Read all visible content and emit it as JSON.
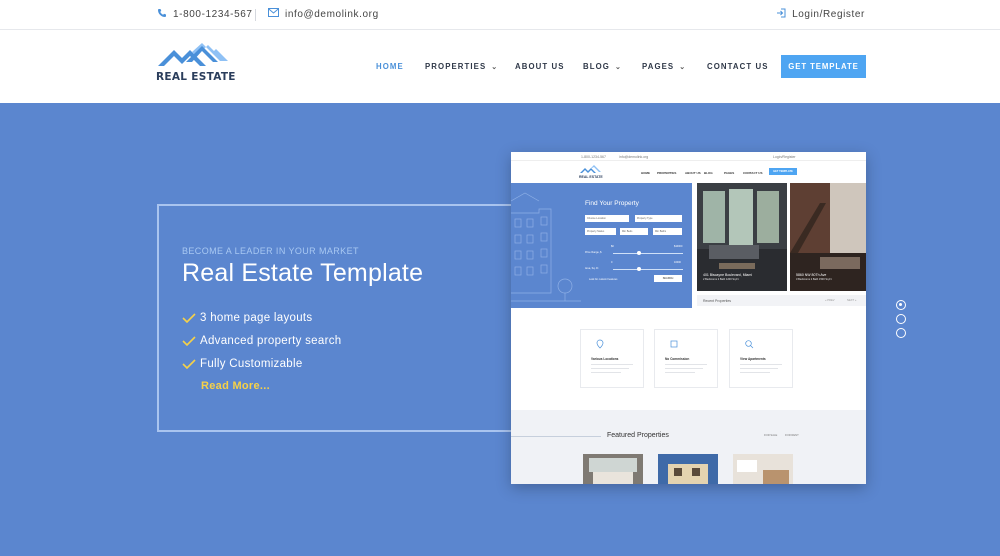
{
  "topbar": {
    "phone": "1-800-1234-567",
    "email": "info@demolink.org",
    "login": "Login/Register",
    "icons": [
      "phone-icon",
      "mail-icon",
      "login-icon"
    ]
  },
  "header": {
    "logo_text": "REAL ESTATE",
    "nav": {
      "home": "HOME",
      "properties": "PROPERTIES",
      "about": "ABOUT US",
      "blog": "BLOG",
      "pages": "PAGES",
      "contact": "CONTACT US"
    },
    "cta": "GET TEMPLATE"
  },
  "hero": {
    "eyebrow": "BECOME A LEADER IN YOUR MARKET",
    "title": "Real Estate Template",
    "features": [
      "3 home page layouts",
      "Advanced property search",
      "Fully Customizable"
    ],
    "read_more": "Read More..."
  },
  "preview": {
    "phone": "1-800-1234-567",
    "email": "info@demolink.org",
    "login": "Login/Register",
    "logo_text": "REAL ESTATE",
    "nav": [
      "HOME",
      "PROPERTIES",
      "ABOUT US",
      "BLOG",
      "PAGES",
      "CONTACT US"
    ],
    "cta": "GET TEMPLATE",
    "search_title": "Find Your Property",
    "fields": [
      "Choose Location",
      "Property Type",
      "Property Status",
      "Min Beds",
      "Min Baths"
    ],
    "range_labels": [
      "Price Range, $",
      "Area, Sq. Ft"
    ],
    "range_values": [
      "$0",
      "$10000",
      "0",
      "10000"
    ],
    "checkbox": "Look for custom Features",
    "search_btn": "SEARCH",
    "photos": [
      {
        "caption": "401 Biscayne Boulevard, Miami",
        "sub": "2 Bedrooms 2 Bath 1200 Sq.Ft"
      },
      {
        "caption": "5860 NW 80Th Ave",
        "sub": "3 Bedrooms 2 Bath 1500 Sq.Ft"
      }
    ],
    "recent": "Recent Properties",
    "recent_links": [
      "« PREV",
      "NEXT »"
    ],
    "cards": [
      "Various Locations",
      "No Commission",
      "View Apartments"
    ],
    "featured_title": "Featured Properties",
    "featured_links": [
      "FOR SALE",
      "FOR RENT"
    ]
  },
  "slider": {
    "dots": 3,
    "active_index": 0
  },
  "colors": {
    "hero_bg": "#5b86cf",
    "accent": "#4ea5f2",
    "read_more": "#f6d148",
    "nav_active": "#4a90d9"
  }
}
